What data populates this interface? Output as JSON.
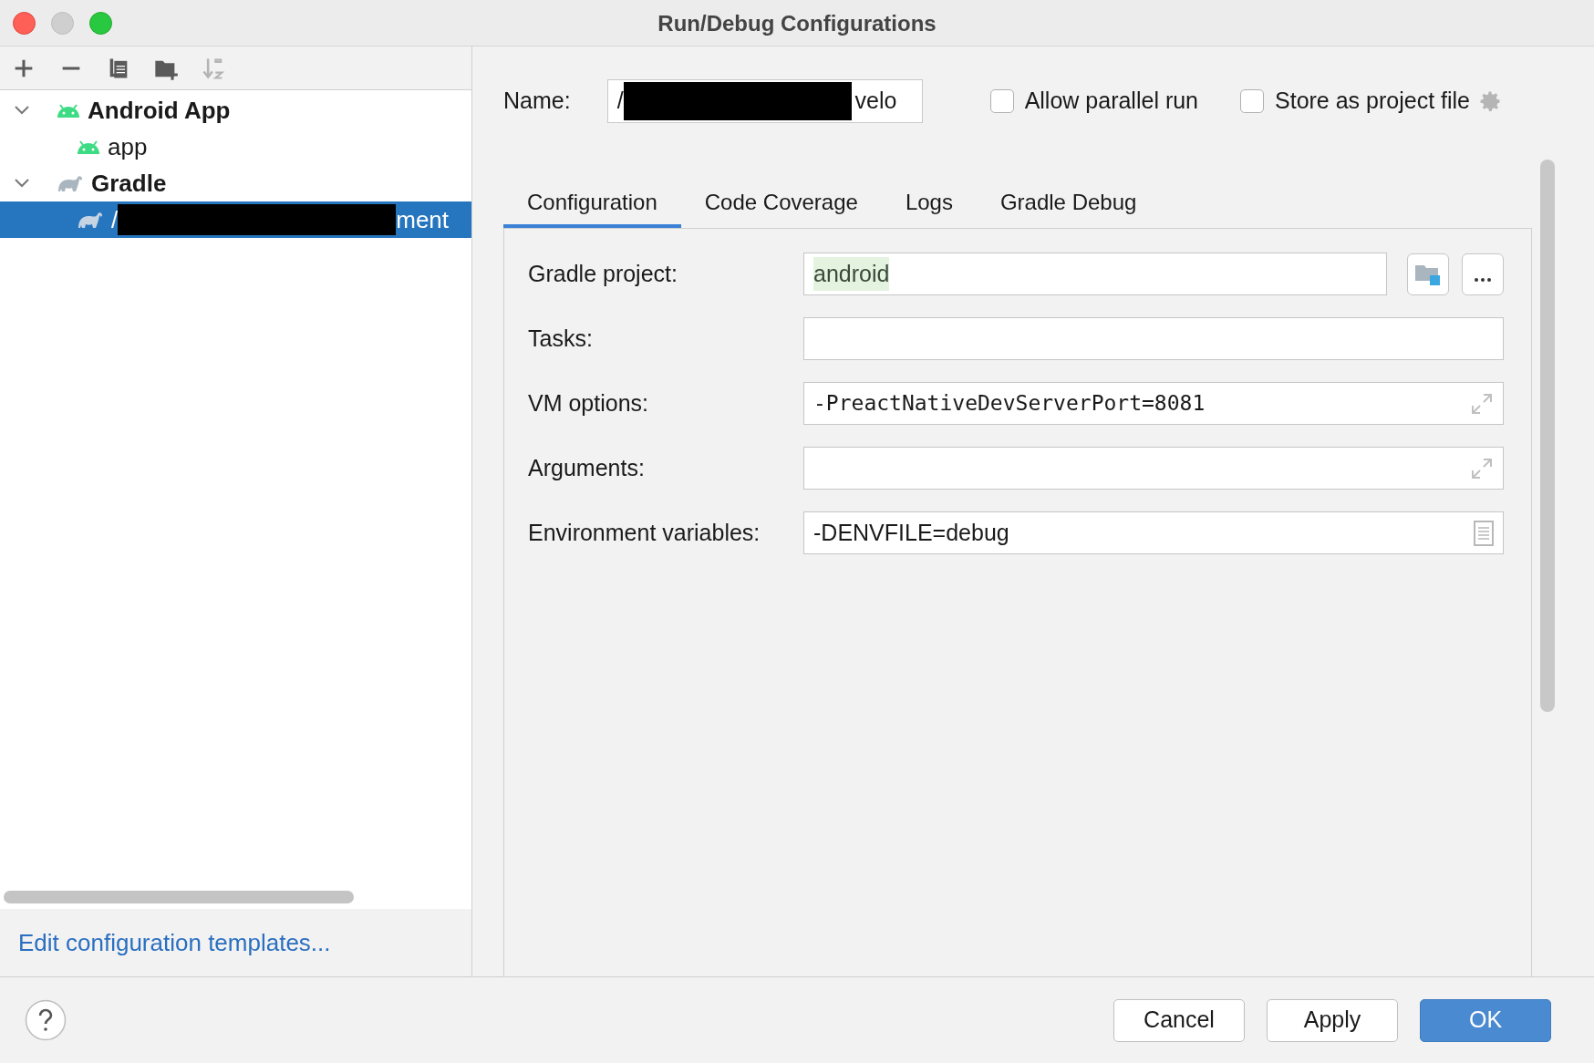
{
  "window": {
    "title": "Run/Debug Configurations"
  },
  "toolbar": [
    {
      "kind": "add"
    },
    {
      "kind": "remove"
    },
    {
      "kind": "copy"
    },
    {
      "kind": "folder"
    },
    {
      "kind": "sort",
      "disabled": true
    }
  ],
  "tree": [
    {
      "label": "Android App",
      "kind": "android",
      "expanded": true,
      "selected": false,
      "children": [
        {
          "label": "app",
          "kind": "android",
          "selected": false
        }
      ]
    },
    {
      "label": "Gradle",
      "kind": "gradle",
      "expanded": true,
      "selected": false,
      "children": [
        {
          "label_start": "/",
          "label_end": "ment",
          "redacted": true,
          "kind": "gradle",
          "selected": true
        }
      ]
    }
  ],
  "templates_link": "Edit configuration templates...",
  "name_field": {
    "label": "Name:",
    "value_start": "/",
    "value_end": "velo",
    "redacted": true
  },
  "options": [
    {
      "label": "Allow parallel run",
      "checked": false
    },
    {
      "label": "Store as project file",
      "checked": false
    }
  ],
  "tabs": [
    {
      "label": "Configuration",
      "selected": true
    },
    {
      "label": "Code Coverage",
      "selected": false
    },
    {
      "label": "Logs",
      "selected": false
    },
    {
      "label": "Gradle Debug",
      "selected": false
    }
  ],
  "fields": [
    {
      "label": "Gradle project:",
      "value": "android",
      "kind": "project"
    },
    {
      "label": "Tasks:",
      "kind": "plain"
    },
    {
      "label": "VM options:",
      "value": "-PreactNativeDevServerPort=8081",
      "kind": "code"
    },
    {
      "label": "Arguments:",
      "kind": "expand"
    },
    {
      "label": "Environment variables:",
      "value": "-DENVFILE=debug",
      "kind": "env"
    }
  ],
  "buttons": [
    {
      "label": "Cancel",
      "default": false
    },
    {
      "label": "Apply",
      "default": false
    },
    {
      "label": "OK",
      "default": true
    }
  ]
}
